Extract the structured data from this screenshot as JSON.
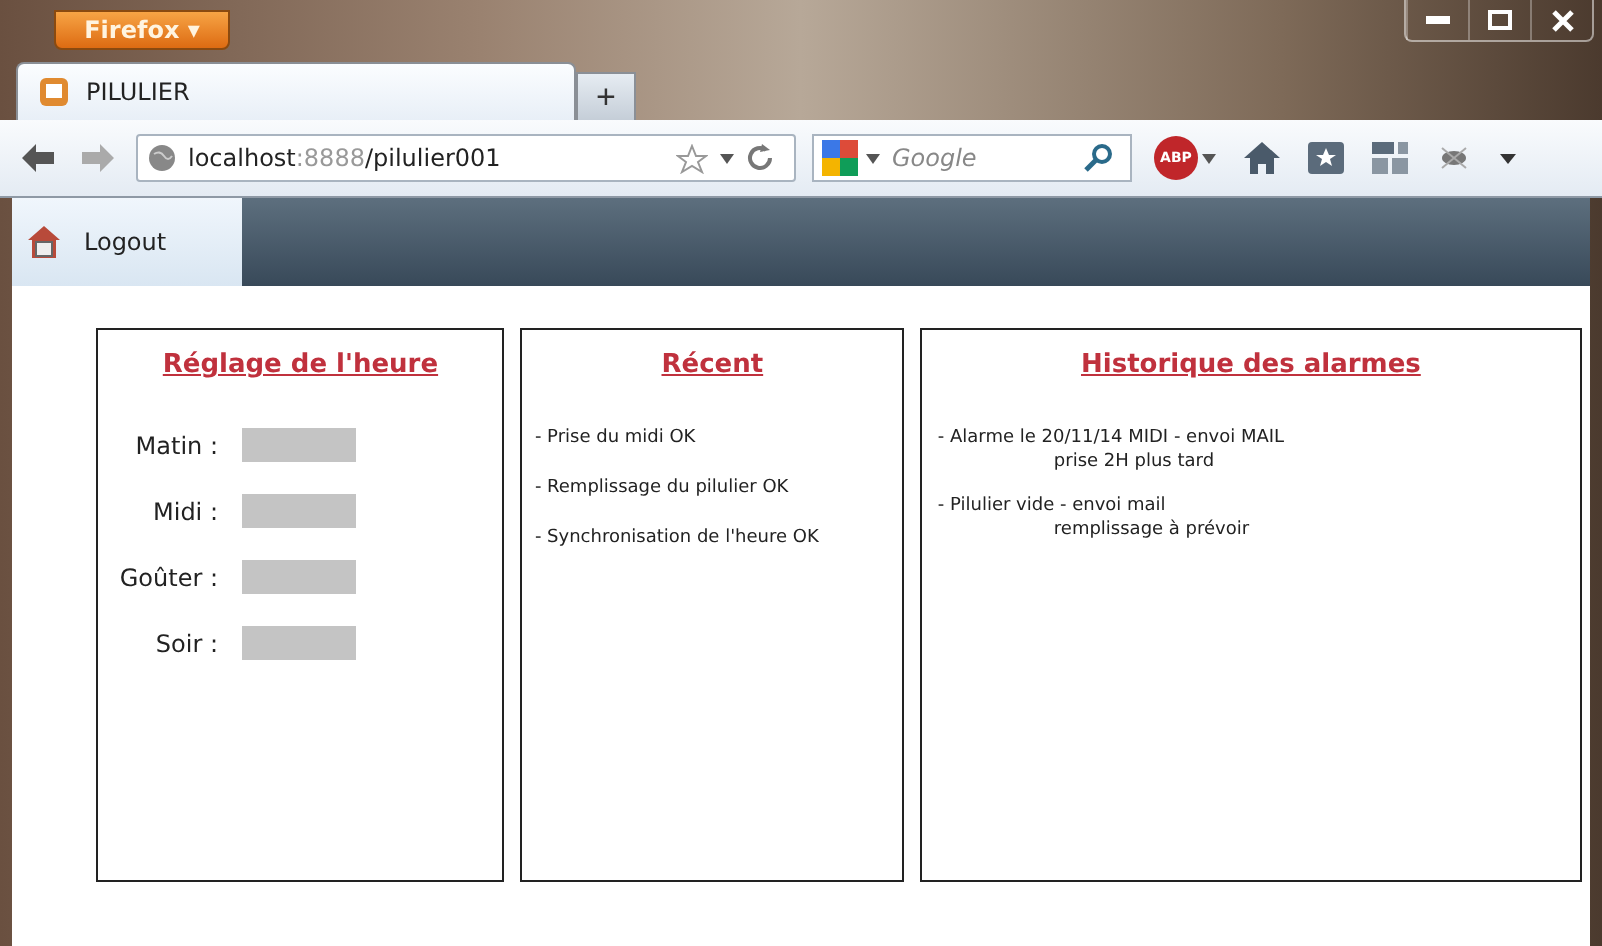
{
  "browser": {
    "menu_button": "Firefox ▾",
    "tabs": [
      {
        "label": "PILULIER",
        "selected": true
      }
    ],
    "new_tab": "+",
    "url_host": "localhost",
    "url_port": ":8888",
    "url_path": "/pilulier001",
    "search_placeholder": "Google",
    "adblock": "ABP"
  },
  "app": {
    "logout": "Logout"
  },
  "settings": {
    "title": "Réglage de l'heure",
    "rows": [
      {
        "label": "Matin :"
      },
      {
        "label": "Midi :"
      },
      {
        "label": "Goûter :"
      },
      {
        "label": "Soir :"
      }
    ]
  },
  "recent": {
    "title": "Récent",
    "items": [
      "- Prise du midi OK",
      "- Remplissage du pilulier OK",
      "- Synchronisation de l'heure OK"
    ]
  },
  "alarms": {
    "title": "Historique des alarmes",
    "items": [
      {
        "text": "- Alarme le 20/11/14 MIDI - envoi MAIL",
        "detail": "prise 2H plus tard"
      },
      {
        "text": "- Pilulier vide - envoi mail",
        "detail": "remplissage à prévoir"
      }
    ]
  }
}
